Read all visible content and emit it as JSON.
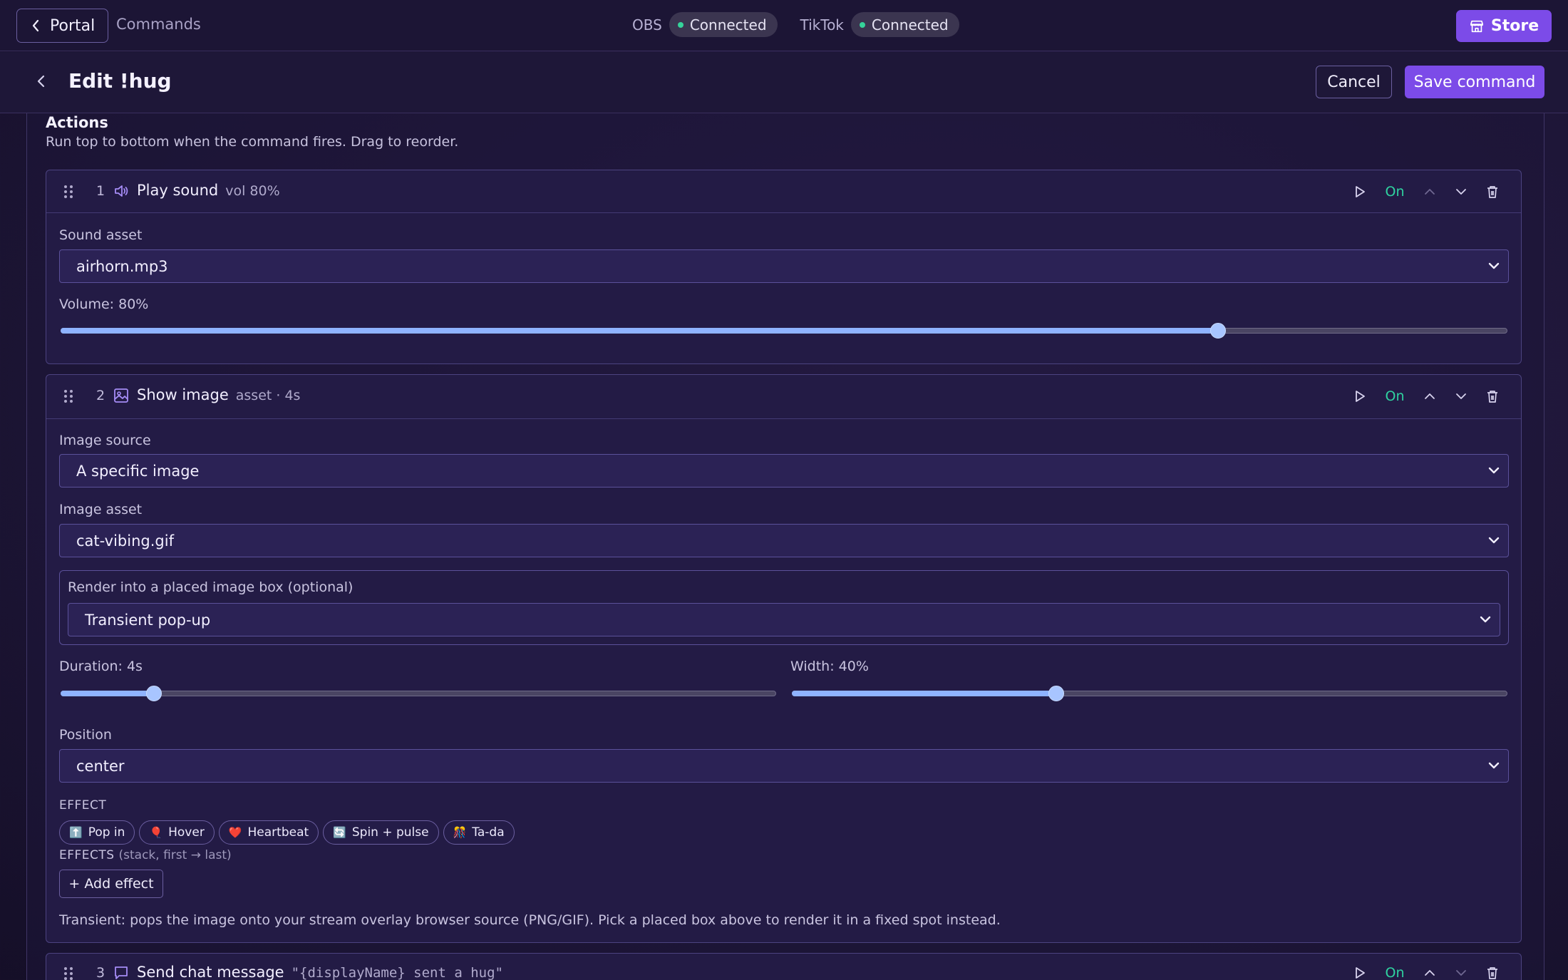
{
  "topbar": {
    "portal_label": "Portal",
    "crumb": "Commands",
    "obs_label": "OBS",
    "obs_status": "Connected",
    "tiktok_label": "TikTok",
    "tiktok_status": "Connected",
    "store_label": "Store",
    "status_color": "#35d39a",
    "accent": "#7c4be8"
  },
  "header": {
    "title": "Edit !hug",
    "cancel_label": "Cancel",
    "save_label": "Save command"
  },
  "actions": {
    "title": "Actions",
    "subtitle": "Run top to bottom when the command fires. Drag to reorder.",
    "items": [
      {
        "index": "1",
        "icon": "speaker-icon",
        "name": "Play sound",
        "meta": "vol 80%",
        "toggle": "On",
        "sound_label": "Sound asset",
        "sound_value": "airhorn.mp3",
        "volume_label": "Volume: 80%",
        "volume": 0.8
      },
      {
        "index": "2",
        "icon": "image-icon",
        "name": "Show image",
        "meta": "asset · 4s",
        "toggle": "On",
        "source_label": "Image source",
        "source_value": "A specific image",
        "asset_label": "Image asset",
        "asset_value": "cat-vibing.gif",
        "render_label": "Render into a placed image box (optional)",
        "render_value": "Transient pop-up",
        "duration_label": "Duration: 4s",
        "duration": 0.13,
        "width_label": "Width: 40%",
        "width": 0.37,
        "position_label": "Position",
        "position_value": "center",
        "effect_heading": "EFFECT",
        "effects": [
          {
            "emoji": "⬆️",
            "label": "Pop in"
          },
          {
            "emoji": "🎈",
            "label": "Hover"
          },
          {
            "emoji": "❤️",
            "label": "Heartbeat"
          },
          {
            "emoji": "🔄",
            "label": "Spin + pulse"
          },
          {
            "emoji": "🎊",
            "label": "Ta-da"
          }
        ],
        "effects_heading": "EFFECTS",
        "effects_hint": "(stack, first → last)",
        "add_effect_label": "+ Add effect",
        "note": "Transient: pops the image onto your stream overlay browser source (PNG/GIF). Pick a placed box above to render it in a fixed spot instead."
      },
      {
        "index": "3",
        "icon": "chat-icon",
        "name": "Send chat message",
        "meta": "\"{displayName} sent a hug\"",
        "toggle": "On"
      }
    ]
  }
}
